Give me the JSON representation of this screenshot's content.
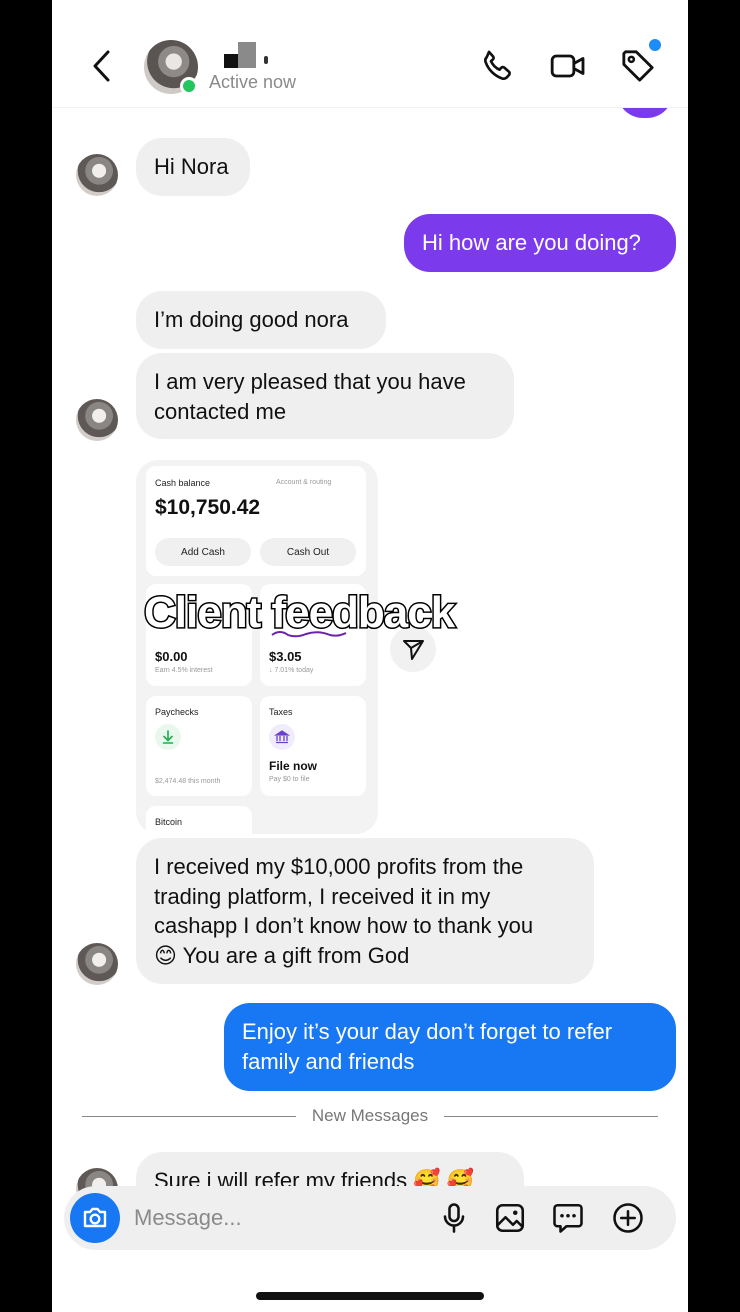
{
  "header": {
    "status": "Active now",
    "icons": [
      "back-chevron-icon",
      "phone-icon",
      "video-icon",
      "tag-icon"
    ]
  },
  "messages": [
    {
      "id": "m1",
      "direction": "incoming",
      "text": "Hi Nora"
    },
    {
      "id": "m2",
      "direction": "outgoing",
      "text": "Hi how are you doing?"
    },
    {
      "id": "m3",
      "direction": "incoming",
      "text": "I’m doing good nora"
    },
    {
      "id": "m4",
      "direction": "incoming",
      "text_lines": [
        "I am very pleased that you have",
        "contacted me"
      ]
    },
    {
      "id": "m6",
      "direction": "incoming",
      "text_lines": [
        "I received my $10,000 profits from the",
        "trading platform, I received it in my",
        "cashapp I don’t know how to thank you",
        "😊 You are a gift from God"
      ]
    },
    {
      "id": "m7",
      "direction": "outgoing",
      "text_lines": [
        "Enjoy it’s your day don’t forget to refer",
        "family and friends"
      ]
    },
    {
      "id": "m8",
      "direction": "incoming",
      "text": "Sure i will refer my friends 🥰 🥰"
    }
  ],
  "shared_image": {
    "cash_balance_label": "Cash balance",
    "account_routing": "Account & routing",
    "balance": "$10,750.42",
    "add_cash": "Add Cash",
    "cash_out": "Cash Out",
    "savings_value": "$0.00",
    "savings_sub": "Earn 4.5% interest",
    "stocks_value": "$3.05",
    "stocks_sub": "↓ 7.01% today",
    "paychecks_label": "Paychecks",
    "paychecks_sub": "$2,474.48 this month",
    "taxes_label": "Taxes",
    "taxes_action": "File now",
    "taxes_sub": "Pay $0 to file",
    "bitcoin_label": "Bitcoin",
    "overlay_text": "Client feedback"
  },
  "separator": {
    "label": "New Messages"
  },
  "composer": {
    "placeholder": "Message..."
  },
  "colors": {
    "outgoing_purple": "#7c3aed",
    "outgoing_blue": "#1877f2",
    "incoming_gray": "#efefef",
    "online_green": "#22c55e"
  }
}
